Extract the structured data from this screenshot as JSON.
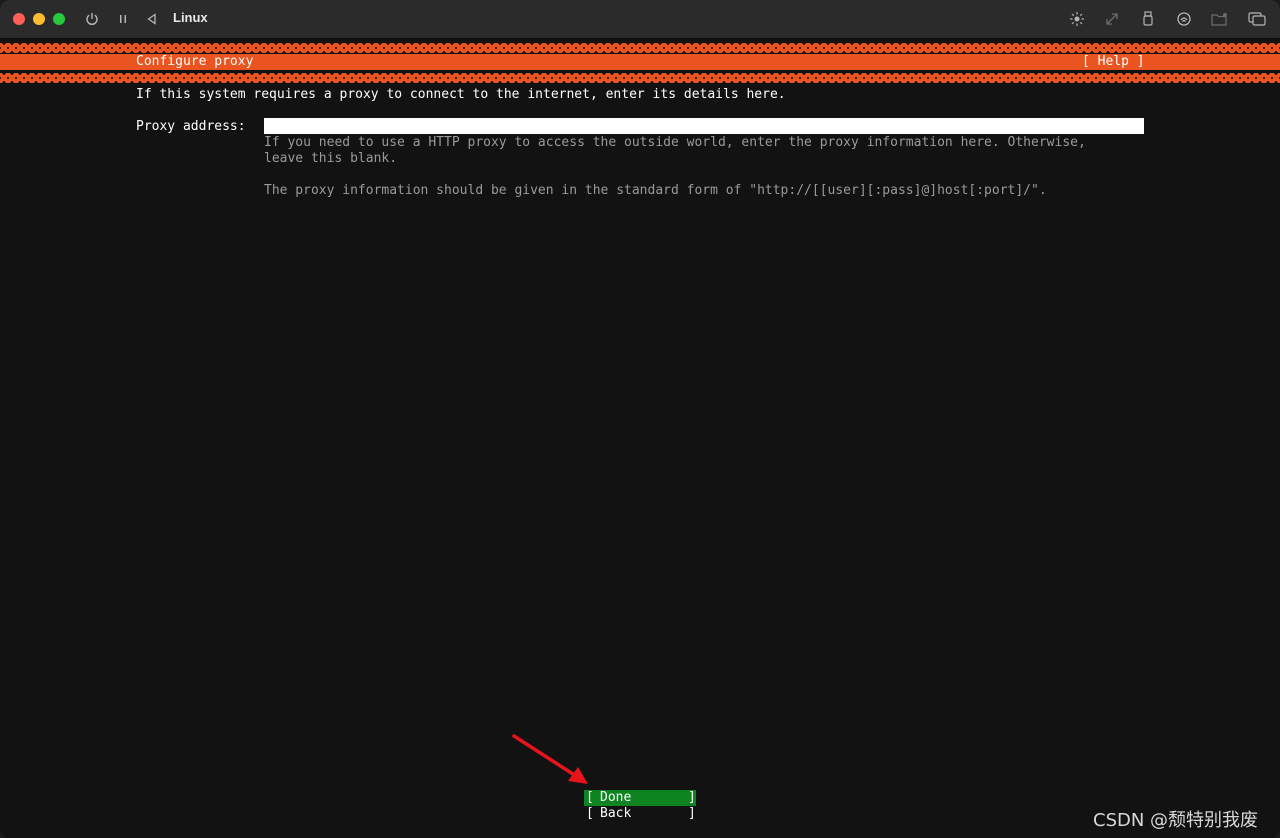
{
  "window": {
    "title": "Linux",
    "traffic_lights": [
      "close",
      "minimize",
      "maximize"
    ],
    "left_controls": [
      "power-icon",
      "pause-icon",
      "back-icon"
    ],
    "right_controls": [
      "brightness-icon",
      "resize-icon",
      "usb-icon",
      "network-icon",
      "folder-icon",
      "display-icon"
    ]
  },
  "installer": {
    "header_title": "Configure proxy",
    "help_label": "[ Help ]",
    "intro": "If this system requires a proxy to connect to the internet, enter its details here.",
    "proxy_field": {
      "label": "Proxy address:",
      "value": ""
    },
    "help_text_line1": "If you need to use a HTTP proxy to access the outside world, enter the proxy information here. Otherwise,",
    "help_text_line2": "leave this blank.",
    "help_text_line3": "The proxy information should be given in the standard form of \"http://[[user][:pass]@]host[:port]/\".",
    "buttons": {
      "done": "Done",
      "back": "Back"
    }
  },
  "colors": {
    "accent": "#e95420",
    "selected_button": "#0e8420",
    "background": "#121212"
  },
  "watermark": "CSDN @颓特别我废"
}
